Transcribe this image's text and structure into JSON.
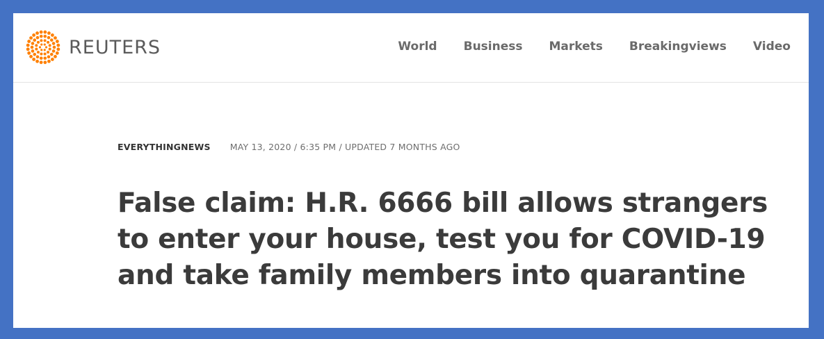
{
  "header": {
    "brand": "REUTERS",
    "logo_icon": "reuters-dot-logo-icon",
    "brand_color": "#ff8000",
    "nav": [
      "World",
      "Business",
      "Markets",
      "Breakingviews",
      "Video"
    ]
  },
  "article": {
    "section": "EVERYTHINGNEWS",
    "dateline": "MAY 13, 2020 / 6:35 PM / UPDATED 7 MONTHS AGO",
    "headline": "False claim: H.R. 6666 bill allows strangers to enter your house, test you for COVID-19 and take family members into quarantine"
  },
  "frame_color": "#4472c4"
}
